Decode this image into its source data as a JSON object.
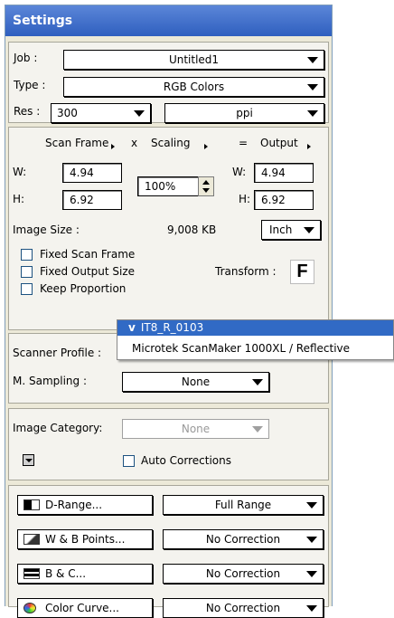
{
  "window": {
    "title": "Settings"
  },
  "job": {
    "label": "Job :",
    "value": "Untitled1"
  },
  "type": {
    "label": "Type :",
    "value": "RGB Colors"
  },
  "res": {
    "label": "Res :",
    "value": "300",
    "unit": "ppi"
  },
  "frame": {
    "scan_frame": "Scan Frame",
    "x": "x",
    "scaling": "Scaling",
    "eq": "=",
    "output": "Output",
    "w_label": "W:",
    "h_label": "H:",
    "scan_w": "4.94",
    "scan_h": "6.92",
    "scaling_value": "100%",
    "out_w": "4.94",
    "out_h": "6.92",
    "image_size_label": "Image Size :",
    "image_size_value": "9,008  KB",
    "size_unit": "Inch",
    "fixed_scan_frame": "Fixed Scan Frame",
    "fixed_output_size": "Fixed Output Size",
    "keep_proportion": "Keep Proportion",
    "transform_label": "Transform :",
    "transform_icon": "F"
  },
  "profile": {
    "label": "Scanner Profile :",
    "menu_items": [
      {
        "label": "IT8_R_0103",
        "checked": true,
        "check_mark": "v"
      },
      {
        "label": "Microtek ScanMaker 1000XL / Reflective",
        "checked": false
      }
    ],
    "msampling_label": "M. Sampling :",
    "msampling_value": "None"
  },
  "category": {
    "label": "Image Category:",
    "value": "None",
    "auto_corrections": "Auto Corrections"
  },
  "tools": [
    {
      "button": "D-Range...",
      "value": "Full Range",
      "icon": "d-range-icon"
    },
    {
      "button": "W & B Points...",
      "value": "No Correction",
      "icon": "wb-points-icon"
    },
    {
      "button": "B & C...",
      "value": "No Correction",
      "icon": "brightness-contrast-icon"
    },
    {
      "button": "Color Curve...",
      "value": "No Correction",
      "icon": "color-icon"
    }
  ],
  "colors": {
    "title_bar": "#2f5fbf",
    "selection": "#316ac5",
    "panel": "#ece9d8"
  }
}
